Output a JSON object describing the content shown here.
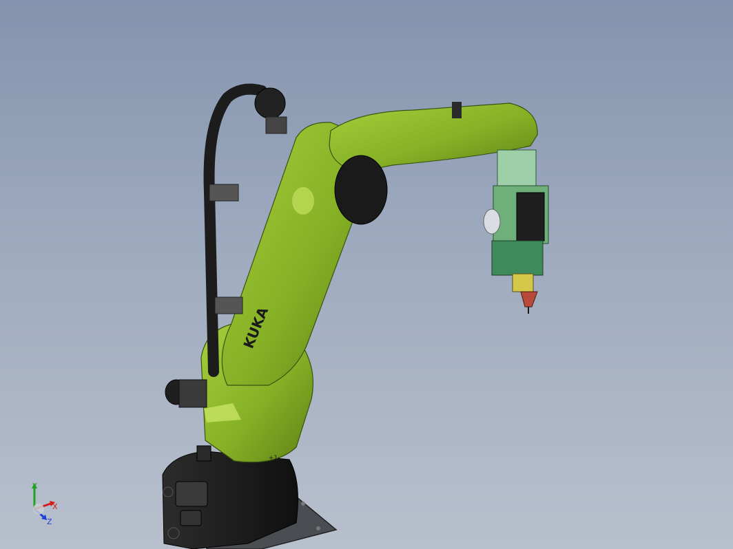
{
  "viewport": {
    "background_top": "#8494ae",
    "background_bottom": "#b8c0cd"
  },
  "robot": {
    "brand_text": "KUKA",
    "axis_marker": "+1-",
    "body_color": "#8ab52a",
    "base_color": "#1c1c1c"
  },
  "triad": {
    "x_label": "X",
    "y_label": "Y",
    "z_label": "Z",
    "x_color": "#d61a1a",
    "y_color": "#21a121",
    "z_color": "#1f3fd6"
  }
}
